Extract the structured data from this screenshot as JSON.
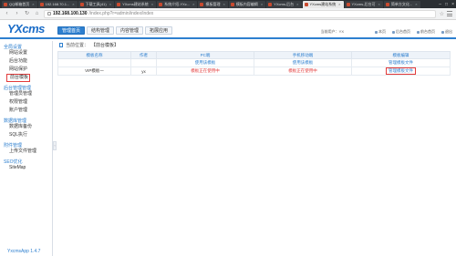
{
  "browser": {
    "tabs": [
      {
        "label": "QQ邮箱首页",
        "active": false
      },
      {
        "label": "192.168.70.1...",
        "active": false
      },
      {
        "label": "下载工具(41)",
        "active": false
      },
      {
        "label": "YXcms建站系统",
        "active": false
      },
      {
        "label": "系统介绍-YXc...",
        "active": false
      },
      {
        "label": "模板管理",
        "active": false
      },
      {
        "label": "模板内容编辑",
        "active": false
      },
      {
        "label": "YXcms-后台",
        "active": false
      },
      {
        "label": "YXcms建站系统",
        "active": true
      },
      {
        "label": "YXcms-后台可",
        "active": false
      },
      {
        "label": "简单方文化...",
        "active": false
      }
    ],
    "url_host": "192.168.100.130",
    "url_path": "/index.php?r=admin/index/index"
  },
  "header": {
    "logo": "YXcms",
    "nav": [
      {
        "label": "管理首页",
        "active": true
      },
      {
        "label": "结构管理",
        "active": false
      },
      {
        "label": "内容管理",
        "active": false
      },
      {
        "label": "拓展应用",
        "active": false
      }
    ],
    "user_label": "当前用户：YX",
    "quick_links": [
      "本页",
      "后台首页",
      "前台首页",
      "退出"
    ]
  },
  "sidebar": {
    "sections": [
      {
        "title": "全局设置",
        "items": [
          {
            "label": "网站设置",
            "highlight": false
          },
          {
            "label": "后台功能",
            "highlight": false
          },
          {
            "label": "网站保护",
            "highlight": false
          },
          {
            "label": "前台模板",
            "highlight": true
          }
        ]
      },
      {
        "title": "后台管理管理",
        "items": [
          {
            "label": "管理员管理",
            "highlight": false
          },
          {
            "label": "权限管理",
            "highlight": false
          },
          {
            "label": "账户管理",
            "highlight": false
          }
        ]
      },
      {
        "title": "数据库管理",
        "items": [
          {
            "label": "数据库备份",
            "highlight": false
          },
          {
            "label": "SQL执行",
            "highlight": false
          }
        ]
      },
      {
        "title": "附件管理",
        "items": [
          {
            "label": "上传文件管理",
            "highlight": false
          }
        ]
      },
      {
        "title": "SEO优化",
        "items": [
          {
            "label": "SiteMap",
            "highlight": false
          }
        ]
      }
    ],
    "version": "YxcmsApp 1.4.7"
  },
  "content": {
    "crumb_label": "当前位置：",
    "crumb_current": "【前台模板】",
    "table": {
      "headers": [
        "模板名称",
        "作者",
        "PC端",
        "手机移动端",
        "模板编辑"
      ],
      "rows": [
        [
          "",
          "",
          "使用该模板",
          "使用该模板",
          "管理模板文件"
        ],
        [
          "VIP模板一",
          "yx",
          "模板正在使用中",
          "模板正在使用中",
          "管理模板文件"
        ]
      ]
    }
  }
}
